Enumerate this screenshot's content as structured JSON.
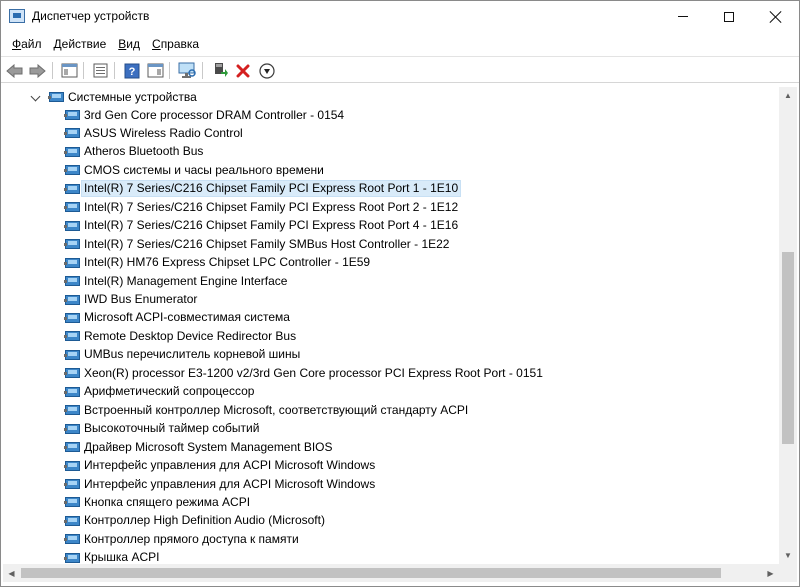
{
  "window": {
    "title": "Диспетчер устройств"
  },
  "menu": [
    {
      "label": "Файл",
      "accel": "Ф",
      "rest": "айл"
    },
    {
      "label": "Действие",
      "accel": "Д",
      "rest": "ействие"
    },
    {
      "label": "Вид",
      "accel": "В",
      "rest": "ид"
    },
    {
      "label": "Справка",
      "accel": "С",
      "rest": "правка"
    }
  ],
  "toolbar": {
    "icons": [
      "back-arrow-icon",
      "forward-arrow-icon",
      "show-hide-console-tree-icon",
      "properties-icon",
      "help-icon",
      "action-pane-icon",
      "scan-hardware-icon",
      "update-driver-icon",
      "uninstall-device-icon",
      "download-icon"
    ]
  },
  "tree": {
    "group_label": "Системные устройства",
    "selected_index": 4,
    "devices": [
      "3rd Gen Core processor DRAM Controller - 0154",
      "ASUS Wireless Radio Control",
      "Atheros Bluetooth Bus",
      "CMOS системы и часы реального времени",
      "Intel(R) 7 Series/C216 Chipset Family PCI Express Root Port 1 - 1E10",
      "Intel(R) 7 Series/C216 Chipset Family PCI Express Root Port 2 - 1E12",
      "Intel(R) 7 Series/C216 Chipset Family PCI Express Root Port 4 - 1E16",
      "Intel(R) 7 Series/C216 Chipset Family SMBus Host Controller - 1E22",
      "Intel(R) HM76 Express Chipset LPC Controller - 1E59",
      "Intel(R) Management Engine Interface",
      "IWD Bus Enumerator",
      "Microsoft ACPI-совместимая система",
      "Remote Desktop Device Redirector Bus",
      "UMBus перечислитель корневой шины",
      "Xeon(R) processor E3-1200 v2/3rd Gen Core processor PCI Express Root Port - 0151",
      "Арифметический сопроцессор",
      "Встроенный контроллер Microsoft, соответствующий стандарту ACPI",
      "Высокоточный таймер событий",
      "Драйвер Microsoft System Management BIOS",
      "Интерфейс управления для ACPI Microsoft Windows",
      "Интерфейс управления для ACPI Microsoft Windows",
      "Кнопка спящего режима ACPI",
      "Контроллер High Definition Audio (Microsoft)",
      "Контроллер прямого доступа к памяти",
      "Крышка ACPI"
    ]
  },
  "colors": {
    "selection": "#d9ebf9",
    "device_icon": "#3c86c8",
    "uninstall_red": "#d42020",
    "update_green": "#2e9a3a"
  }
}
